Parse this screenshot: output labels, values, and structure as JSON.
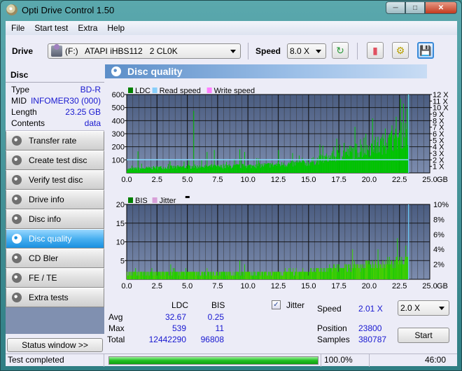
{
  "window": {
    "title": "Opti Drive Control 1.50",
    "buttons": [
      "minimize",
      "maximize",
      "close"
    ]
  },
  "menu": [
    "File",
    "Start test",
    "Extra",
    "Help"
  ],
  "toolbar": {
    "drive_label": "Drive",
    "drive_value": "(F:)   ATAPI iHBS112   2 CL0K",
    "speed_label": "Speed",
    "speed_value": "8.0 X",
    "icons": [
      "refresh-icon",
      "eraser-icon",
      "settings-icon",
      "save-icon"
    ]
  },
  "disc": {
    "header": "Disc",
    "rows": [
      {
        "label": "Type",
        "value": "BD-R"
      },
      {
        "label": "MID",
        "value": "INFOMER30 (000)"
      },
      {
        "label": "Length",
        "value": "23.25 GB"
      },
      {
        "label": "Contents",
        "value": "data"
      }
    ]
  },
  "nav": [
    {
      "label": "Transfer rate",
      "active": false
    },
    {
      "label": "Create test disc",
      "active": false
    },
    {
      "label": "Verify test disc",
      "active": false
    },
    {
      "label": "Drive info",
      "active": false
    },
    {
      "label": "Disc info",
      "active": false
    },
    {
      "label": "Disc quality",
      "active": true
    },
    {
      "label": "CD Bler",
      "active": false
    },
    {
      "label": "FE / TE",
      "active": false
    },
    {
      "label": "Extra tests",
      "active": false
    }
  ],
  "status_window_label": "Status window >>",
  "panel_title": "Disc quality",
  "chart_data": [
    {
      "type": "bar",
      "title": "LDC",
      "legend": [
        {
          "name": "LDC",
          "color": "#008000"
        },
        {
          "name": "Read speed",
          "color": "#87cefa"
        },
        {
          "name": "Write speed",
          "color": "#ff80ff"
        }
      ],
      "legend_placement": "top-left",
      "xlabel": "GB",
      "x_ticks": [
        "0.0",
        "2.5",
        "5.0",
        "7.5",
        "10.0",
        "12.5",
        "15.0",
        "17.5",
        "20.0",
        "22.5",
        "25.0"
      ],
      "xlim": [
        0,
        25
      ],
      "ylim": [
        0,
        600
      ],
      "y_ticks": [
        "100",
        "200",
        "300",
        "400",
        "500",
        "600"
      ],
      "y2_ticks": [
        "1 X",
        "2 X",
        "3 X",
        "4 X",
        "5 X",
        "6 X",
        "7 X",
        "8 X",
        "9 X",
        "10 X",
        "11 X",
        "12 X"
      ],
      "y2lim": [
        0,
        12
      ],
      "grid": true,
      "ldc_profile": {
        "x": [
          0,
          1,
          2,
          3,
          4,
          5,
          6,
          7,
          8,
          9,
          10,
          11,
          12,
          13,
          14,
          15,
          16,
          17,
          18,
          19,
          20,
          21,
          22,
          23.25
        ],
        "base": [
          30,
          35,
          40,
          45,
          45,
          50,
          50,
          50,
          50,
          55,
          55,
          60,
          65,
          70,
          75,
          85,
          110,
          130,
          160,
          180,
          200,
          230,
          270,
          330
        ],
        "spikes": [
          [
            0.9,
            165
          ],
          [
            5.5,
            475
          ],
          [
            6.6,
            160
          ],
          [
            7.2,
            175
          ],
          [
            9.3,
            180
          ],
          [
            9.7,
            160
          ],
          [
            12.5,
            175
          ],
          [
            17.9,
            230
          ],
          [
            19.7,
            300
          ],
          [
            21.3,
            340
          ],
          [
            22.2,
            430
          ],
          [
            22.8,
            530
          ],
          [
            23.1,
            490
          ]
        ]
      },
      "read_speed_x": 2.01,
      "end_marker_gb": 23.25
    },
    {
      "type": "bar",
      "title": "BIS",
      "legend": [
        {
          "name": "BIS",
          "color": "#008000"
        },
        {
          "name": "Jitter",
          "color": "#d8a0d8"
        }
      ],
      "legend_placement": "top-left",
      "xlabel": "GB",
      "x_ticks": [
        "0.0",
        "2.5",
        "5.0",
        "7.5",
        "10.0",
        "12.5",
        "15.0",
        "17.5",
        "20.0",
        "22.5",
        "25.0"
      ],
      "xlim": [
        0,
        25
      ],
      "ylim": [
        0,
        20
      ],
      "y_ticks": [
        "5",
        "10",
        "15",
        "20"
      ],
      "y2_ticks": [
        "2%",
        "4%",
        "6%",
        "8%",
        "10%"
      ],
      "y2lim": [
        0,
        10
      ],
      "grid": true,
      "bis_profile": {
        "x": [
          0,
          2.5,
          5,
          7.5,
          10,
          12.5,
          15,
          17.5,
          20,
          22.5,
          23.25
        ],
        "base": [
          2,
          2,
          2,
          2,
          2,
          2,
          2.5,
          3.5,
          4.5,
          5.5,
          6
        ],
        "spikes": [
          [
            3.6,
            4
          ],
          [
            9.3,
            5
          ],
          [
            9.7,
            4
          ],
          [
            18.6,
            8
          ],
          [
            20.7,
            8
          ],
          [
            22.3,
            11
          ],
          [
            23.0,
            9
          ]
        ]
      },
      "end_marker_gb": 23.25
    }
  ],
  "stats": {
    "headers": [
      "LDC",
      "BIS"
    ],
    "rows": [
      {
        "label": "Avg",
        "ldc": "32.67",
        "bis": "0.25"
      },
      {
        "label": "Max",
        "ldc": "539",
        "bis": "11"
      },
      {
        "label": "Total",
        "ldc": "12442290",
        "bis": "96808"
      }
    ],
    "jitter_label": "Jitter",
    "jitter_checked": true,
    "speed_label": "Speed",
    "speed_value": "2.01 X",
    "speed_select": "2.0 X",
    "position_label": "Position",
    "position_value": "23800",
    "samples_label": "Samples",
    "samples_value": "380787",
    "start_label": "Start"
  },
  "statusbar": {
    "status": "Test completed",
    "progress_percent": 100.0,
    "progress_text": "100.0%",
    "elapsed": "46:00"
  }
}
